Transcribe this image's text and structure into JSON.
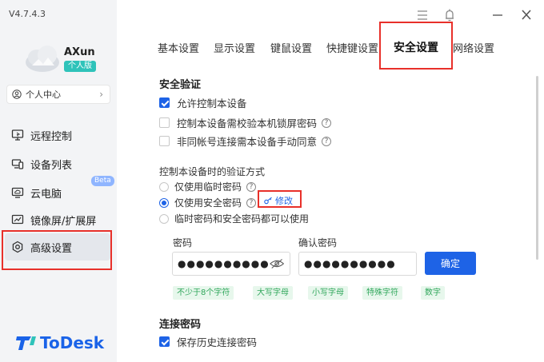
{
  "app": {
    "version": "V4.7.4.3",
    "brand": "ToDesk"
  },
  "user": {
    "name": "AXun",
    "edition": "个人版",
    "profile_label": "个人中心"
  },
  "sidebar": {
    "items": [
      {
        "label": "远程控制",
        "icon": "remote-control-icon"
      },
      {
        "label": "设备列表",
        "icon": "device-list-icon"
      },
      {
        "label": "云电脑",
        "icon": "cloud-pc-icon",
        "badge": "Beta"
      },
      {
        "label": "镜像屏/扩展屏",
        "icon": "mirror-screen-icon"
      },
      {
        "label": "高级设置",
        "icon": "advanced-settings-icon",
        "active": true
      }
    ]
  },
  "tabs": [
    "基本设置",
    "显示设置",
    "键鼠设置",
    "快捷键设置",
    "安全设置",
    "网络设置"
  ],
  "active_tab": "安全设置",
  "security": {
    "title": "安全验证",
    "allow_control": {
      "label": "允许控制本设备",
      "checked": true
    },
    "require_lock_pwd": {
      "label": "控制本设备需校验本机锁屏密码",
      "checked": false
    },
    "manual_approve": {
      "label": "非同帐号连接需本设备手动同意",
      "checked": false
    }
  },
  "verify": {
    "title": "控制本设备时的验证方式",
    "options": [
      {
        "label": "仅使用临时密码",
        "selected": false
      },
      {
        "label": "仅使用安全密码",
        "selected": true
      },
      {
        "label": "临时密码和安全密码都可以使用",
        "selected": false
      }
    ],
    "modify_label": "修改"
  },
  "password": {
    "label": "密码",
    "value": "●●●●●●●●●●",
    "confirm_label": "确认密码",
    "confirm_value": "●●●●●●●●●●",
    "confirm_button": "确定",
    "rules": [
      "不少于8个字符",
      "大写字母",
      "小写字母",
      "特殊字符",
      "数字"
    ]
  },
  "connection_pwd": {
    "title": "连接密码",
    "save_history": {
      "label": "保存历史连接密码",
      "checked": true
    }
  },
  "colors": {
    "accent": "#1e63e6",
    "highlight": "#e8302a",
    "edition": "#2fc3ba",
    "rule_tag": "#31a75c"
  }
}
